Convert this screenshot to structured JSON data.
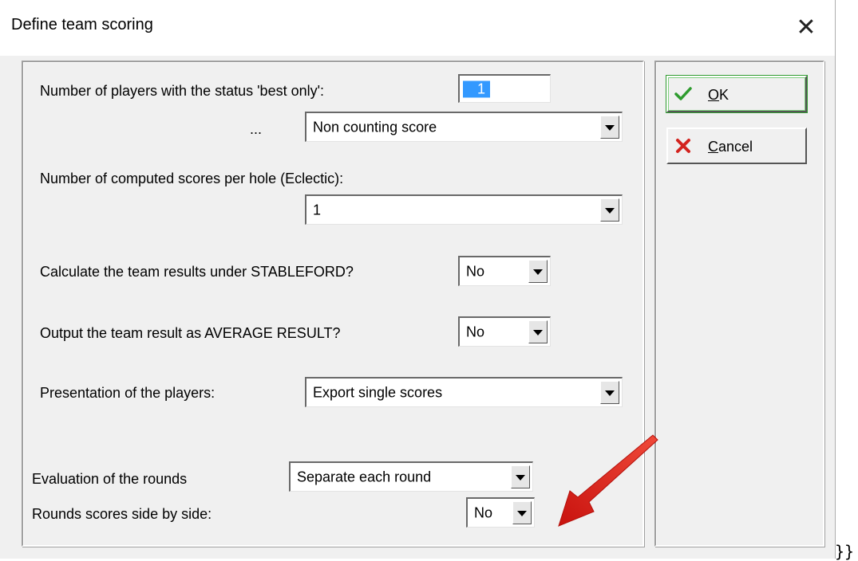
{
  "window": {
    "title": "Define team scoring"
  },
  "fields": {
    "best_only_label": "Number of players with the status 'best only':",
    "best_only_value": "1",
    "ellipsis_label": "...",
    "best_only_mode": "Non counting score",
    "eclectic_label": "Number of computed scores per hole (Eclectic):",
    "eclectic_value": "1",
    "stableford_label": "Calculate the team results under STABLEFORD?",
    "stableford_value": "No",
    "average_label": "Output the team result as AVERAGE RESULT?",
    "average_value": "No",
    "presentation_label": "Presentation of the players:",
    "presentation_value": "Export single scores",
    "rounds_eval_label": "Evaluation of the rounds",
    "rounds_eval_value": "Separate each round",
    "side_by_side_label": "Rounds scores side by side:",
    "side_by_side_value": "No"
  },
  "buttons": {
    "ok_mnemonic": "O",
    "ok_rest": "K",
    "cancel_mnemonic": "C",
    "cancel_rest": "ancel"
  },
  "stray_text": "}}",
  "colors": {
    "ok_check": "#2e9b2e",
    "cancel_x": "#d3231e",
    "arrow": "#e02020",
    "selection": "#3399ff"
  },
  "icons": {
    "close": "close-icon",
    "ok": "checkmark-icon",
    "cancel": "red-x-icon",
    "dropdown": "chevron-down-icon",
    "annotation": "red-arrow-icon"
  }
}
